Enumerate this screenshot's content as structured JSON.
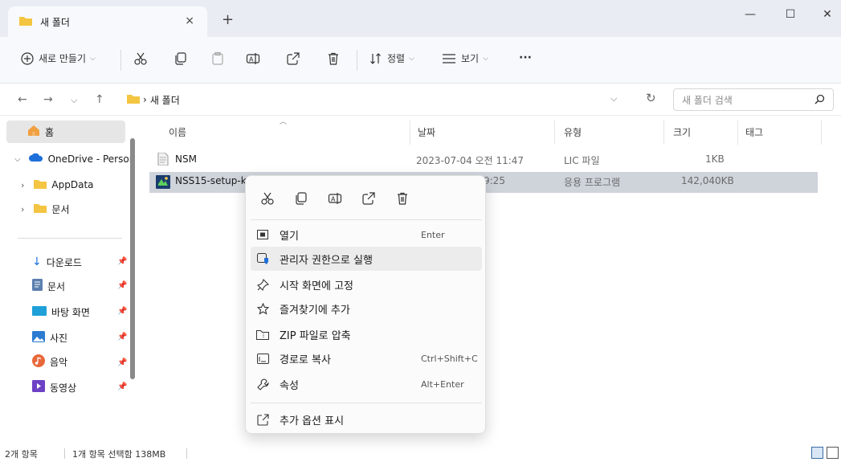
{
  "tab": {
    "title": "새 폴더",
    "close": "×",
    "new": "+"
  },
  "window": {
    "minimize": "—",
    "maximize": "☐",
    "close": "✕"
  },
  "toolbar": {
    "new_label": "새로 만들기",
    "sort_label": "정렬",
    "view_label": "보기",
    "more_label": "···"
  },
  "address": {
    "path": "새 폴더",
    "search_placeholder": "새 폴더 검색"
  },
  "sidebar": {
    "items": [
      {
        "label": "홈"
      },
      {
        "label": "OneDrive - Persor"
      },
      {
        "label": "AppData"
      },
      {
        "label": "문서"
      },
      {
        "label": "다운로드"
      },
      {
        "label": "문서"
      },
      {
        "label": "바탕 화면"
      },
      {
        "label": "사진"
      },
      {
        "label": "음악"
      },
      {
        "label": "동영상"
      }
    ]
  },
  "columns": [
    "이름",
    "날짜",
    "유형",
    "크기",
    "태그"
  ],
  "files": [
    {
      "name": "NSM",
      "date": "2023-07-04 오전 11:47",
      "type": "LIC 파일",
      "size": "1KB"
    },
    {
      "name": "NSS15-setup-kc",
      "date": "9:25",
      "type": "응용 프로그램",
      "size": "142,040KB"
    }
  ],
  "context_menu": {
    "items": [
      {
        "label": "열기",
        "shortcut": "Enter"
      },
      {
        "label": "관리자 권한으로 실행",
        "shortcut": ""
      },
      {
        "label": "시작 화면에 고정",
        "shortcut": ""
      },
      {
        "label": "즐겨찾기에 추가",
        "shortcut": ""
      },
      {
        "label": "ZIP 파일로 압축",
        "shortcut": ""
      },
      {
        "label": "경로로 복사",
        "shortcut": "Ctrl+Shift+C"
      },
      {
        "label": "속성",
        "shortcut": "Alt+Enter"
      },
      {
        "label": "추가 옵션 표시",
        "shortcut": ""
      }
    ]
  },
  "status": {
    "count": "2개 항목",
    "selection": "1개 항목 선택함 138MB"
  },
  "colors": {
    "folder": "#f4c542",
    "onedrive": "#1e6fd9",
    "selected_row": "#cfd4db",
    "accent": "#3a6ea5"
  }
}
